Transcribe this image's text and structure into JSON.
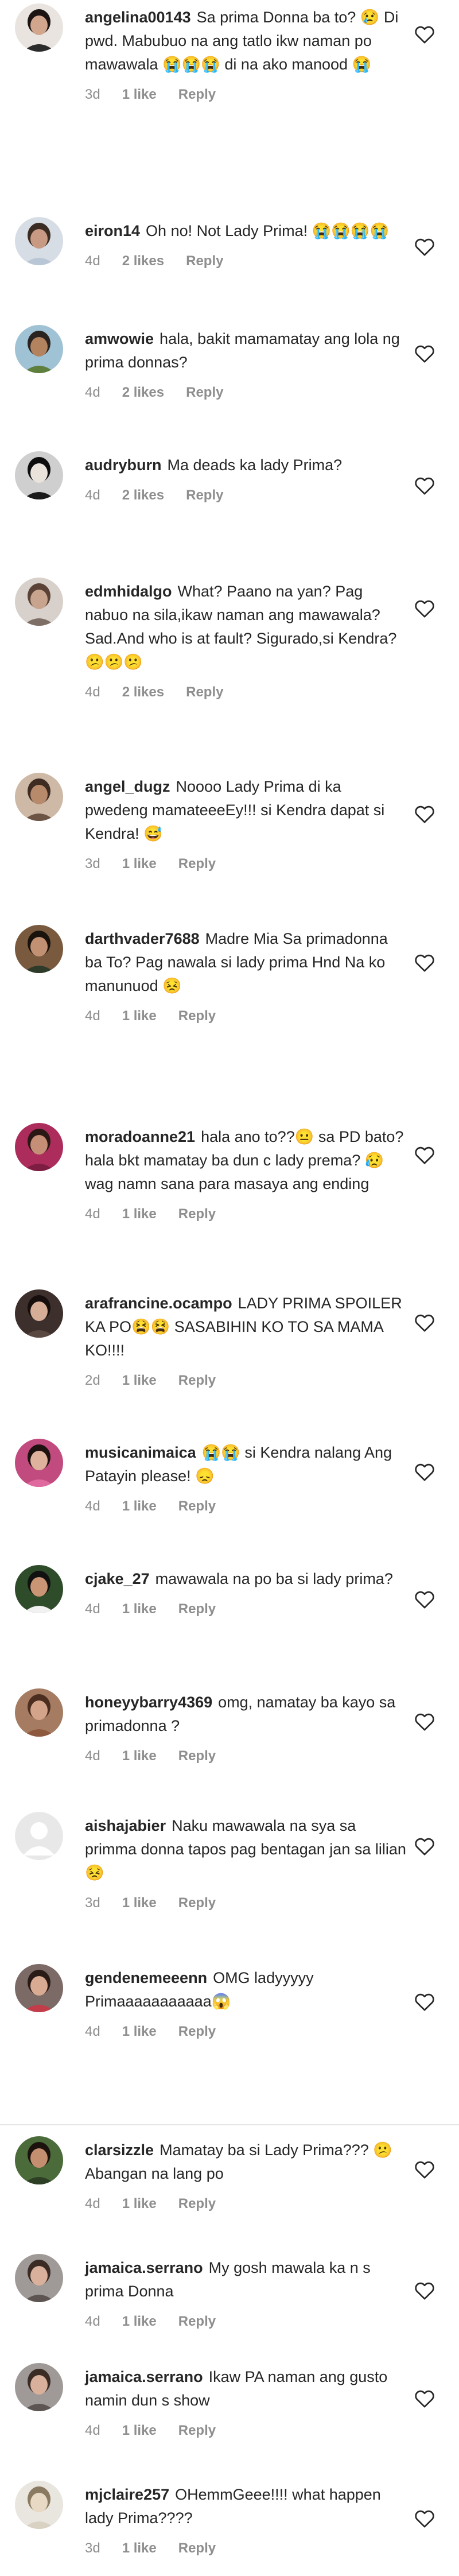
{
  "like_icon": "heart-outline-icon",
  "comments": [
    {
      "username": "angelina00143",
      "text": "Sa prima Donna ba to? 😢 Di pwd. Mabubuo na ang tatlo ikw naman po mawawala 😭😭😭 di na ako manood 😭",
      "age": "3d",
      "likes": "1 like",
      "reply": "Reply",
      "avatar": {
        "bg": "#e9e4df",
        "skin": "#d2a58d",
        "hair": "#1b1413",
        "shirt": "#2b2b2b"
      }
    },
    {
      "username": "eiron14",
      "text": "Oh no! Not Lady Prima! 😭😭😭😭",
      "age": "4d",
      "likes": "2 likes",
      "reply": "Reply",
      "avatar": {
        "bg": "#d7dde4",
        "skin": "#c99a83",
        "hair": "#3a2c22",
        "shirt": "#b9c6d6"
      }
    },
    {
      "username": "amwowie",
      "text": "hala, bakit mamamatay ang lola ng prima donnas?",
      "age": "4d",
      "likes": "2 likes",
      "reply": "Reply",
      "avatar": {
        "bg": "#9fc2d4",
        "skin": "#b3825f",
        "hair": "#2a2320",
        "shirt": "#5f7f3e"
      }
    },
    {
      "username": "audryburn",
      "text": "Ma deads ka lady Prima?",
      "age": "4d",
      "likes": "2 likes",
      "reply": "Reply",
      "avatar": {
        "bg": "#cfcfcf",
        "skin": "#e9e3dc",
        "hair": "#0d0d0d",
        "shirt": "#1a1a1a"
      }
    },
    {
      "username": "edmhidalgo",
      "text": "What? Paano na yan? Pag nabuo na sila,ikaw naman ang mawawala? Sad.And who is at fault? Sigurado,si Kendra?😕😕😕",
      "age": "4d",
      "likes": "2 likes",
      "reply": "Reply",
      "avatar": {
        "bg": "#d8d1cb",
        "skin": "#c8a48e",
        "hair": "#5a4336",
        "shirt": "#7e6f66"
      }
    },
    {
      "username": "angel_dugz",
      "text": "Noooo Lady Prima di ka pwedeng mamateeeEy!!! si Kendra dapat si Kendra! 😅",
      "age": "3d",
      "likes": "1 like",
      "reply": "Reply",
      "avatar": {
        "bg": "#cdb9a6",
        "skin": "#b88a6c",
        "hair": "#3e2c22",
        "shirt": "#6b5444"
      }
    },
    {
      "username": "darthvader7688",
      "text": "Madre Mia Sa primadonna ba To? Pag nawala si lady prima Hnd Na ko manunuod 😣",
      "age": "4d",
      "likes": "1 like",
      "reply": "Reply",
      "avatar": {
        "bg": "#7a5a3e",
        "skin": "#c29072",
        "hair": "#1a120d",
        "shirt": "#2f3b2a"
      }
    },
    {
      "username": "moradoanne21",
      "text": "hala ano to??😐 sa PD bato? hala bkt mamatay ba dun c lady prema? 😥wag namn sana para masaya ang ending",
      "age": "4d",
      "likes": "1 like",
      "reply": "Reply",
      "avatar": {
        "bg": "#ac2c5c",
        "skin": "#c58e76",
        "hair": "#2a1815",
        "shirt": "#7d1d42"
      }
    },
    {
      "username": "arafrancine.ocampo",
      "text": "LADY PRIMA SPOILER KA PO😫😫 SASABIHIN KO TO SA MAMA KO!!!!",
      "age": "2d",
      "likes": "1 like",
      "reply": "Reply",
      "avatar": {
        "bg": "#3d2f2b",
        "skin": "#d6ad96",
        "hair": "#150e0c",
        "shirt": "#5a4842"
      }
    },
    {
      "username": "musicanimaica",
      "text": "😭😭 si Kendra nalang Ang Patayin please! 😞",
      "age": "4d",
      "likes": "1 like",
      "reply": "Reply",
      "avatar": {
        "bg": "#c14a7f",
        "skin": "#deb29c",
        "hair": "#1e1210",
        "shirt": "#e06aa0"
      }
    },
    {
      "username": "cjake_27",
      "text": "mawawala na po ba si lady prima?",
      "age": "4d",
      "likes": "1 like",
      "reply": "Reply",
      "avatar": {
        "bg": "#2f4c2a",
        "skin": "#c99575",
        "hair": "#111111",
        "shirt": "#f1f1f1"
      }
    },
    {
      "username": "honeyybarry4369",
      "text": "omg, namatay ba kayo sa primadonna ?",
      "age": "4d",
      "likes": "1 like",
      "reply": "Reply",
      "avatar": {
        "bg": "#a57c62",
        "skin": "#d3a489",
        "hair": "#4b2e1f",
        "shirt": "#8e5a3f"
      }
    },
    {
      "username": "aishajabier",
      "text": "Naku mawawala na sya sa primma donna tapos pag bentagan jan sa lilian😣",
      "age": "3d",
      "likes": "1 like",
      "reply": "Reply",
      "avatar": {
        "bg": "#e8e8e8",
        "skin": "#ffffff",
        "hair": "#e8e8e8",
        "shirt": "#ffffff",
        "default": true
      }
    },
    {
      "username": "gendenemeeenn",
      "text": "OMG ladyyyyy Primaaaaaaaaaaa😱",
      "age": "4d",
      "likes": "1 like",
      "reply": "Reply",
      "avatar": {
        "bg": "#7c6a66",
        "skin": "#d8ab92",
        "hair": "#2b1b17",
        "shirt": "#c23c4a"
      }
    },
    {
      "username": "clarsizzle",
      "text": "Mamatay ba si Lady Prima??? 😕 Abangan na lang po",
      "age": "4d",
      "likes": "1 like",
      "reply": "Reply",
      "avatar": {
        "bg": "#4b6b3a",
        "skin": "#c48f70",
        "hair": "#1b120e",
        "shirt": "#2d3f24"
      }
    },
    {
      "username": "jamaica.serrano",
      "text": "My gosh mawala ka n s prima Donna",
      "age": "4d",
      "likes": "1 like",
      "reply": "Reply",
      "avatar": {
        "bg": "#9f9a97",
        "skin": "#d8b09b",
        "hair": "#3a2b24",
        "shirt": "#5c5552"
      }
    },
    {
      "username": "jamaica.serrano",
      "text": "Ikaw PA naman ang gusto namin dun s show",
      "age": "4d",
      "likes": "1 like",
      "reply": "Reply",
      "avatar": {
        "bg": "#9f9a97",
        "skin": "#d8b09b",
        "hair": "#3a2b24",
        "shirt": "#5c5552"
      }
    },
    {
      "username": "mjclaire257",
      "text": "OHemmGeee!!!! what happen lady Prima????",
      "age": "3d",
      "likes": "1 like",
      "reply": "Reply",
      "avatar": {
        "bg": "#e9e6df",
        "skin": "#e7d9c4",
        "hair": "#8a7a62",
        "shirt": "#d9d2c3"
      }
    }
  ]
}
